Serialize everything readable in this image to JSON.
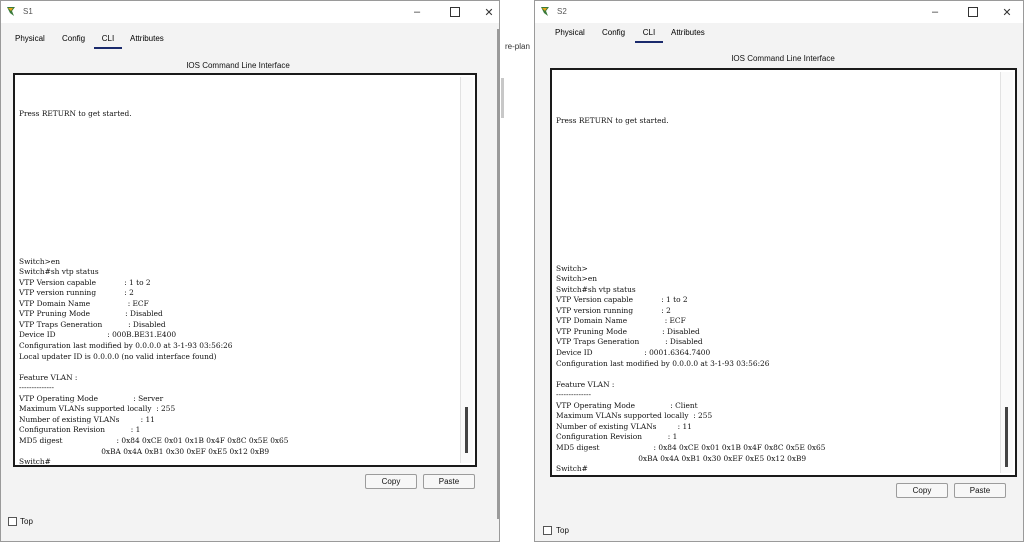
{
  "background": {
    "partial_text": "re-plan"
  },
  "windows": [
    {
      "title": "S1",
      "tabs": [
        {
          "label": "Physical",
          "active": false
        },
        {
          "label": "Config",
          "active": false
        },
        {
          "label": "CLI",
          "active": true
        },
        {
          "label": "Attributes",
          "active": false
        }
      ],
      "panel_title": "IOS Command Line Interface",
      "cli_text": "Press RETURN to get started.\n\n\n\n\n\n\n\n\n\n\n\n\n\nSwitch>en\nSwitch#sh vtp status\nVTP Version capable            : 1 to 2\nVTP version running            : 2\nVTP Domain Name                : ECF\nVTP Pruning Mode               : Disabled\nVTP Traps Generation           : Disabled\nDevice ID                      : 000B.BE31.E400\nConfiguration last modified by 0.0.0.0 at 3-1-93 03:56:26\nLocal updater ID is 0.0.0.0 (no valid interface found)\n\nFeature VLAN :\n--------------\nVTP Operating Mode               : Server\nMaximum VLANs supported locally  : 255\nNumber of existing VLANs         : 11\nConfiguration Revision           : 1\nMD5 digest                       : 0x84 0xCE 0x01 0x1B 0x4F 0x8C 0x5E 0x65\n                                   0xBA 0x4A 0xB1 0x30 0xEF 0xE5 0x12 0xB9\nSwitch#",
      "copy_label": "Copy",
      "paste_label": "Paste",
      "top_label": "Top"
    },
    {
      "title": "S2",
      "tabs": [
        {
          "label": "Physical",
          "active": false
        },
        {
          "label": "Config",
          "active": false
        },
        {
          "label": "CLI",
          "active": true
        },
        {
          "label": "Attributes",
          "active": false
        }
      ],
      "panel_title": "IOS Command Line Interface",
      "cli_text": "Press RETURN to get started.\n\n\n\n\n\n\n\n\n\n\n\n\n\nSwitch>\nSwitch>en\nSwitch#sh vtp status\nVTP Version capable            : 1 to 2\nVTP version running            : 2\nVTP Domain Name                : ECF\nVTP Pruning Mode               : Disabled\nVTP Traps Generation           : Disabled\nDevice ID                      : 0001.6364.7400\nConfiguration last modified by 0.0.0.0 at 3-1-93 03:56:26\n\nFeature VLAN :\n--------------\nVTP Operating Mode               : Client\nMaximum VLANs supported locally  : 255\nNumber of existing VLANs         : 11\nConfiguration Revision           : 1\nMD5 digest                       : 0x84 0xCE 0x01 0x1B 0x4F 0x8C 0x5E 0x65\n                                   0xBA 0x4A 0xB1 0x30 0xEF 0xE5 0x12 0xB9\nSwitch#",
      "copy_label": "Copy",
      "paste_label": "Paste",
      "top_label": "Top"
    }
  ],
  "icons": {
    "app": "packet-tracer-icon",
    "minimize": "minimize-icon",
    "maximize": "maximize-icon",
    "close": "close-icon"
  },
  "colors": {
    "accent_tab": "#1a2a6c",
    "cli_border": "#1a1a1a"
  }
}
